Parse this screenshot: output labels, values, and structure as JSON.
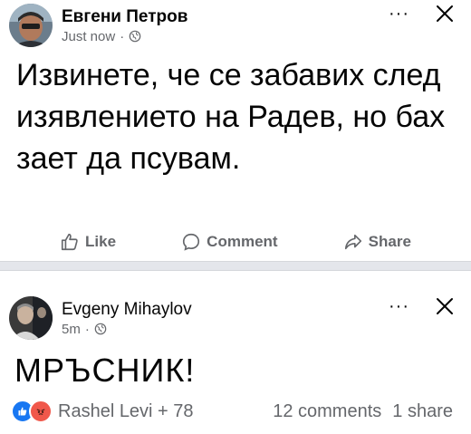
{
  "post1": {
    "author": "Евгени Петров",
    "time": "Just now",
    "separator": "·",
    "more": "···",
    "text": "Извинете, че се забавих след изявлението на Радев, но бах зает да псувам.",
    "actions": {
      "like": "Like",
      "comment": "Comment",
      "share": "Share"
    }
  },
  "post2": {
    "author": "Evgeny Mihaylov",
    "time": "5m",
    "separator": "·",
    "more": "···",
    "text": "МРЪСНИК!",
    "reactions_text": "Rashel Levi + 78",
    "comments": "12 comments",
    "shares": "1 share"
  },
  "icons": [
    "globe-icon",
    "more-icon",
    "close-icon",
    "like-icon",
    "comment-icon",
    "share-icon",
    "like-reaction-icon",
    "angry-reaction-icon"
  ],
  "colors": {
    "muted": "#65676b",
    "text": "#050505",
    "like_blue": "#1877f2",
    "angry": "#f0584b",
    "divider": "#e4e6eb"
  }
}
